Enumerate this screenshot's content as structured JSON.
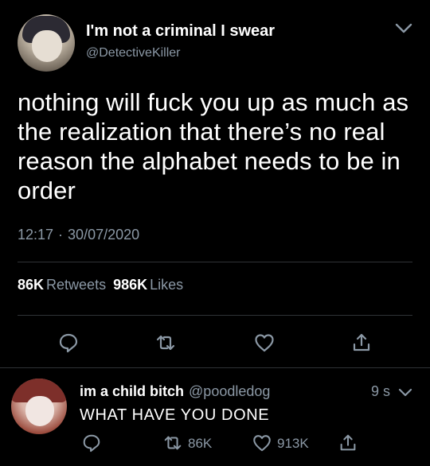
{
  "tweet": {
    "display_name": "I'm not a criminal I swear",
    "handle": "@DetectiveKiller",
    "text": "nothing will fuck you up as much as the realization that there’s no real reason the alphabet needs to be in order",
    "time": "12:17",
    "separator": "·",
    "date": "30/07/2020",
    "retweets_count": "86K",
    "retweets_label": "Retweets",
    "likes_count": "986K",
    "likes_label": "Likes"
  },
  "reply": {
    "display_name": "im a child bitch",
    "handle": "@poodledog",
    "age": "9 s",
    "text": "WHAT HAVE YOU DONE",
    "retweets": "86K",
    "likes": "913K"
  },
  "icons": {
    "chevron": "chevron-down-icon",
    "reply": "reply-icon",
    "retweet": "retweet-icon",
    "like": "heart-icon",
    "share": "share-icon"
  },
  "colors": {
    "background": "#000000",
    "text": "#ffffff",
    "secondary": "#8b98a5",
    "divider": "#2f3336"
  }
}
